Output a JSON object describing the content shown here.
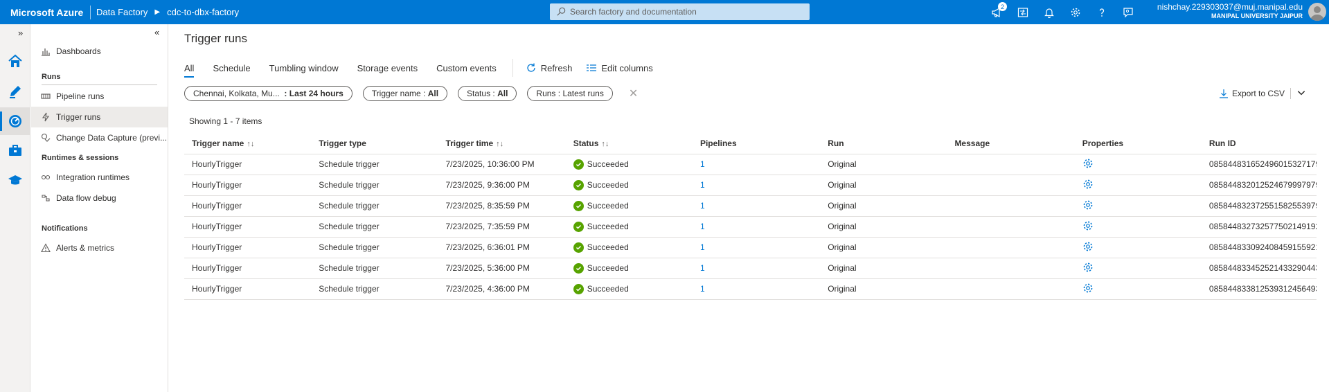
{
  "topbar": {
    "brand": "Microsoft Azure",
    "breadcrumb": [
      "Data Factory",
      "cdc-to-dbx-factory"
    ],
    "search_placeholder": "Search factory and documentation",
    "notification_count": "2",
    "user_email": "nishchay.229303037@muj.manipal.edu",
    "user_org": "MANIPAL UNIVERSITY JAIPUR"
  },
  "nav": {
    "dashboards": "Dashboards",
    "runs_header": "Runs",
    "pipeline_runs": "Pipeline runs",
    "trigger_runs": "Trigger runs",
    "change_data_capture": "Change Data Capture (previ...",
    "runtimes_header": "Runtimes & sessions",
    "integration_runtimes": "Integration runtimes",
    "data_flow_debug": "Data flow debug",
    "notifications_header": "Notifications",
    "alerts_metrics": "Alerts & metrics"
  },
  "main": {
    "title": "Trigger runs",
    "tabs": [
      "All",
      "Schedule",
      "Tumbling window",
      "Storage events",
      "Custom events"
    ],
    "refresh": "Refresh",
    "edit_columns": "Edit columns",
    "filters": {
      "timezone": "Chennai, Kolkata, Mu...",
      "time_range": ": Last 24 hours",
      "trigger_name_label": "Trigger name :",
      "trigger_name_value": "All",
      "status_label": "Status :",
      "status_value": "All",
      "runs_label": "Runs :",
      "runs_value": "Latest runs"
    },
    "export": "Export to CSV",
    "showing": "Showing 1 - 7 items"
  },
  "table": {
    "headers": {
      "trigger_name": "Trigger name",
      "trigger_type": "Trigger type",
      "trigger_time": "Trigger time",
      "status": "Status",
      "pipelines": "Pipelines",
      "run": "Run",
      "message": "Message",
      "properties": "Properties",
      "run_id": "Run ID"
    },
    "rows": [
      {
        "name": "HourlyTrigger",
        "type": "Schedule trigger",
        "time": "7/23/2025, 10:36:00 PM",
        "status": "Succeeded",
        "pipelines": "1",
        "run": "Original",
        "message": "",
        "run_id": "085844831652496015327179..."
      },
      {
        "name": "HourlyTrigger",
        "type": "Schedule trigger",
        "time": "7/23/2025, 9:36:00 PM",
        "status": "Succeeded",
        "pipelines": "1",
        "run": "Original",
        "message": "",
        "run_id": "085844832012524679997979..."
      },
      {
        "name": "HourlyTrigger",
        "type": "Schedule trigger",
        "time": "7/23/2025, 8:35:59 PM",
        "status": "Succeeded",
        "pipelines": "1",
        "run": "Original",
        "message": "",
        "run_id": "085844832372551582553979..."
      },
      {
        "name": "HourlyTrigger",
        "type": "Schedule trigger",
        "time": "7/23/2025, 7:35:59 PM",
        "status": "Succeeded",
        "pipelines": "1",
        "run": "Original",
        "message": "",
        "run_id": "085844832732577502149192..."
      },
      {
        "name": "HourlyTrigger",
        "type": "Schedule trigger",
        "time": "7/23/2025, 6:36:01 PM",
        "status": "Succeeded",
        "pipelines": "1",
        "run": "Original",
        "message": "",
        "run_id": "085844833092408459155921..."
      },
      {
        "name": "HourlyTrigger",
        "type": "Schedule trigger",
        "time": "7/23/2025, 5:36:00 PM",
        "status": "Succeeded",
        "pipelines": "1",
        "run": "Original",
        "message": "",
        "run_id": "085844833452521433290443..."
      },
      {
        "name": "HourlyTrigger",
        "type": "Schedule trigger",
        "time": "7/23/2025, 4:36:00 PM",
        "status": "Succeeded",
        "pipelines": "1",
        "run": "Original",
        "message": "",
        "run_id": "085844833812539312456493..."
      }
    ]
  },
  "colors": {
    "accent": "#0078d4",
    "success": "#57a300"
  }
}
